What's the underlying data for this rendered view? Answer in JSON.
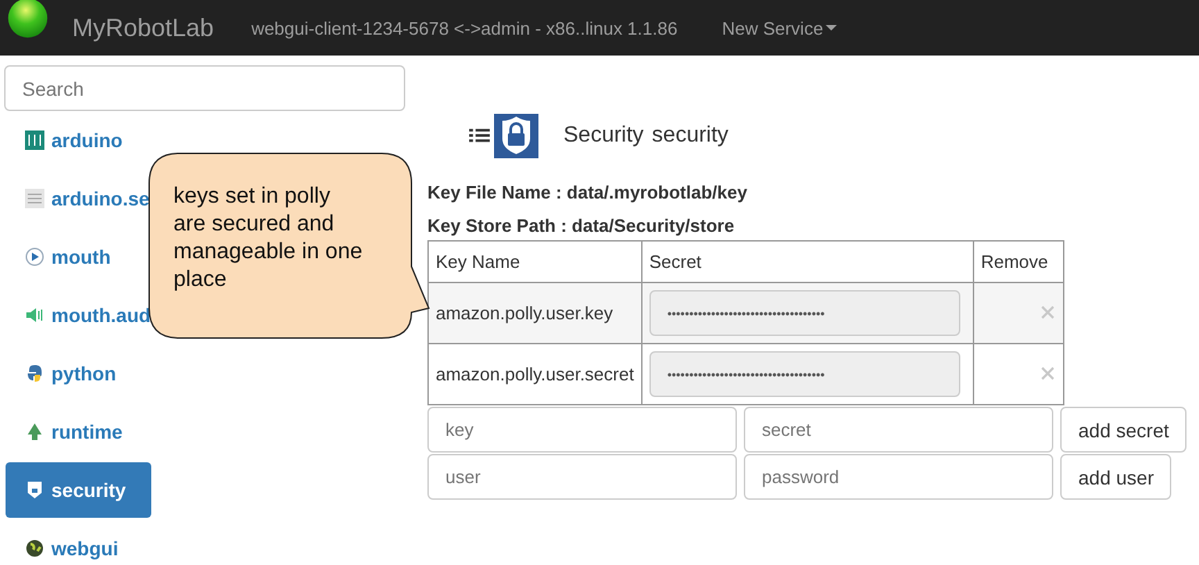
{
  "navbar": {
    "brand": "MyRobotLab",
    "connection": "webgui-client-1234-5678 <->admin - x86..linux 1.1.86",
    "menu": "New Service"
  },
  "sidebar": {
    "search": {
      "placeholder": "Search"
    },
    "items": [
      {
        "label": "arduino",
        "selected": false
      },
      {
        "label": "arduino.se",
        "selected": false
      },
      {
        "label": "mouth",
        "selected": false
      },
      {
        "label": "mouth.aud",
        "selected": false
      },
      {
        "label": "python",
        "selected": false
      },
      {
        "label": "runtime",
        "selected": false
      },
      {
        "label": "security",
        "selected": true
      },
      {
        "label": "webgui",
        "selected": false
      }
    ]
  },
  "callout": {
    "text": "keys set in polly are secured and manageable in one place"
  },
  "panel": {
    "type": "Security",
    "name": "security",
    "key_file": "Key File Name : data/.myrobotlab/key",
    "key_store": "Key Store Path : data/Security/store",
    "table": {
      "columns": [
        "Key Name",
        "Secret",
        "Remove"
      ],
      "rows": [
        {
          "key_name": "amazon.polly.user.key",
          "secret": "••••••••••••••••••••••••••••••••••••"
        },
        {
          "key_name": "amazon.polly.user.secret",
          "secret": "••••••••••••••••••••••••••••••••••••"
        }
      ]
    },
    "forms": [
      {
        "first": {
          "placeholder": "key"
        },
        "second": {
          "placeholder": "secret"
        },
        "button": "add secret"
      },
      {
        "first": {
          "placeholder": "user"
        },
        "second": {
          "placeholder": "password"
        },
        "button": "add user"
      }
    ]
  }
}
